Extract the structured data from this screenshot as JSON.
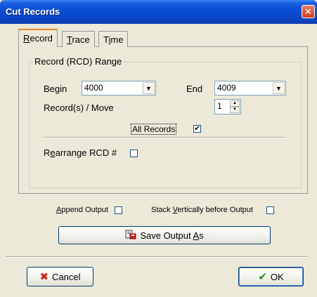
{
  "window": {
    "title": "Cut Records",
    "close_glyph": "✕"
  },
  "tabs": [
    {
      "label": "Record",
      "active": true
    },
    {
      "label": "Trace",
      "active": false
    },
    {
      "label": "Time",
      "active": false
    }
  ],
  "range_group": {
    "legend": "Record (RCD) Range",
    "begin_label": "Begin",
    "begin_value": "4000",
    "end_label": "End",
    "end_value": "4009",
    "move_label": "Record(s) / Move",
    "move_value": "1",
    "all_records_label": "All Records",
    "all_records_checked": "✔",
    "rearrange_label": "Rearrange RCD #"
  },
  "output": {
    "append_label": "Append Output",
    "stack_label": "Stack Vertically before Output",
    "save_label": "Save Output As"
  },
  "footer": {
    "cancel_label": "Cancel",
    "ok_label": "OK"
  },
  "icons": {
    "cancel": "x-icon",
    "ok": "checkmark-icon",
    "save": "save-file-icon"
  }
}
